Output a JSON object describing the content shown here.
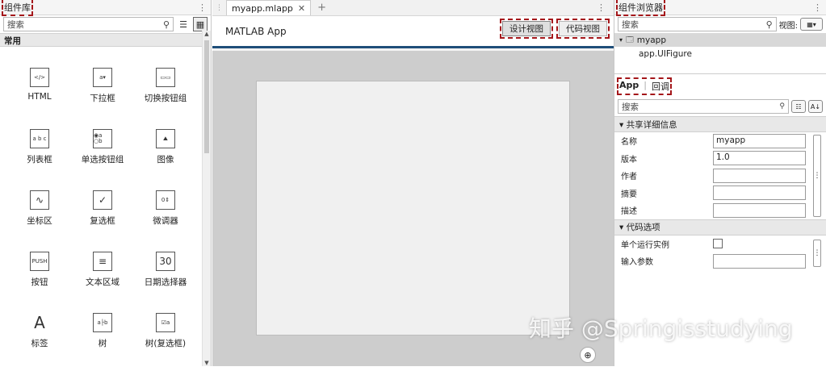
{
  "left": {
    "title": "组件库",
    "search_placeholder": "搜索",
    "section": "常用",
    "components": [
      {
        "label": "HTML",
        "icon": "html-icon",
        "glyph": "</>"
      },
      {
        "label": "下拉框",
        "icon": "dropdown-icon",
        "glyph": "a▾"
      },
      {
        "label": "切换按钮组",
        "icon": "toggle-button-group-icon",
        "glyph": "▭▭"
      },
      {
        "label": "列表框",
        "icon": "listbox-icon",
        "glyph": "a b c"
      },
      {
        "label": "单选按钮组",
        "icon": "radio-button-group-icon",
        "glyph": "◉a ○b"
      },
      {
        "label": "图像",
        "icon": "image-icon",
        "glyph": "⛰"
      },
      {
        "label": "坐标区",
        "icon": "axes-icon",
        "glyph": "∿"
      },
      {
        "label": "复选框",
        "icon": "checkbox-icon",
        "glyph": "✓"
      },
      {
        "label": "微调器",
        "icon": "spinner-icon",
        "glyph": "0⇕"
      },
      {
        "label": "按钮",
        "icon": "push-button-icon",
        "glyph": "PUSH"
      },
      {
        "label": "文本区域",
        "icon": "text-area-icon",
        "glyph": "≡"
      },
      {
        "label": "日期选择器",
        "icon": "date-picker-icon",
        "glyph": "30"
      },
      {
        "label": "标签",
        "icon": "label-icon",
        "glyph": "A"
      },
      {
        "label": "树",
        "icon": "tree-icon",
        "glyph": "a├b"
      },
      {
        "label": "树(复选框)",
        "icon": "checkbox-tree-icon",
        "glyph": "☑a"
      }
    ]
  },
  "center": {
    "tab_label": "myapp.mlapp",
    "app_title": "MATLAB App",
    "design_view": "设计视图",
    "code_view": "代码视图"
  },
  "right": {
    "title": "组件浏览器",
    "search_placeholder": "搜索",
    "view_label": "视图:",
    "tree_root": "myapp",
    "tree_child": "app.UIFigure",
    "tab_app": "App",
    "tab_callbacks": "回调",
    "props_search_placeholder": "搜索",
    "section_details": "▾ 共享详细信息",
    "fields": [
      {
        "key": "名称",
        "value": "myapp"
      },
      {
        "key": "版本",
        "value": "1.0"
      },
      {
        "key": "作者",
        "value": ""
      },
      {
        "key": "摘要",
        "value": ""
      },
      {
        "key": "描述",
        "value": ""
      }
    ],
    "section_code": "▾ 代码选项",
    "single_instance": "单个运行实例",
    "input_args": "输入参数"
  },
  "watermark": "知乎 @Springisstudying",
  "colors": {
    "accent": "#1f4e79",
    "annotation": "#a4161a"
  }
}
